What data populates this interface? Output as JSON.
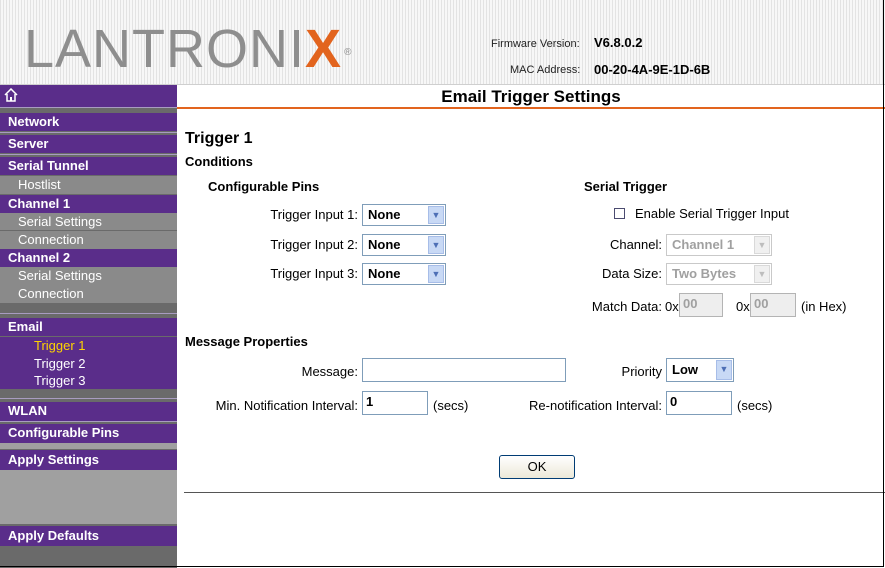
{
  "header": {
    "logo_text": "LANTRONIX",
    "logo_reg": "®",
    "firmware_label": "Firmware Version:",
    "firmware_value": "V6.8.0.2",
    "mac_label": "MAC Address:",
    "mac_value": "00-20-4A-9E-1D-6B"
  },
  "sidebar": {
    "home_icon": "home-icon",
    "items": {
      "network": "Network",
      "server": "Server",
      "serial_tunnel": "Serial Tunnel",
      "hostlist": "Hostlist",
      "channel1": "Channel 1",
      "ch1_serial": "Serial Settings",
      "ch1_connection": "Connection",
      "channel2": "Channel 2",
      "ch2_serial": "Serial Settings",
      "ch2_connection": "Connection",
      "email": "Email",
      "trigger1": "Trigger 1",
      "trigger2": "Trigger 2",
      "trigger3": "Trigger 3",
      "wlan": "WLAN",
      "configurable_pins": "Configurable Pins",
      "apply_settings": "Apply Settings",
      "apply_defaults": "Apply Defaults"
    },
    "active_color": "#ffd400"
  },
  "page": {
    "title": "Email Trigger Settings",
    "trigger_heading": "Trigger 1",
    "conditions": "Conditions",
    "configurable_pins": "Configurable Pins",
    "serial_trigger": "Serial Trigger",
    "inputs": [
      {
        "label": "Trigger Input 1:",
        "value": "None"
      },
      {
        "label": "Trigger Input 2:",
        "value": "None"
      },
      {
        "label": "Trigger Input 3:",
        "value": "None"
      }
    ],
    "enable_serial_label": "Enable Serial Trigger Input",
    "channel_label": "Channel:",
    "channel_value": "Channel 1",
    "data_size_label": "Data Size:",
    "data_size_value": "Two Bytes",
    "match_label": "Match Data:",
    "match_prefix1": "0x",
    "match_value1": "00",
    "match_prefix2": "0x",
    "match_value2": "00",
    "match_suffix": "(in Hex)",
    "message_props": "Message Properties",
    "message_label": "Message:",
    "message_value": "",
    "priority_label": "Priority",
    "priority_value": "Low",
    "min_interval_label": "Min. Notification Interval:",
    "min_interval_value": "1",
    "secs1": "(secs)",
    "renotify_label": "Re-notification Interval:",
    "renotify_value": "0",
    "secs2": "(secs)",
    "ok_label": "OK"
  },
  "colors": {
    "accent_orange": "#e2641e",
    "nav_purple": "#5a2d8a",
    "sidebar_gray": "#6a6a6a"
  }
}
